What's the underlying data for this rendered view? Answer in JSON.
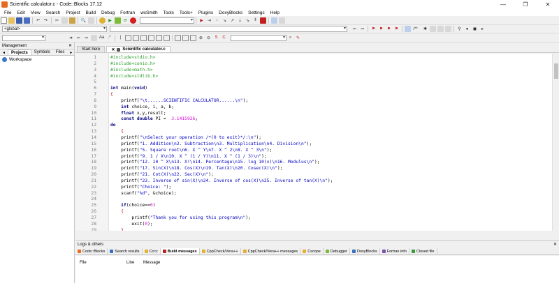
{
  "window": {
    "title": "Scientific calculator.c - Code::Blocks 17.12"
  },
  "menu": [
    "File",
    "Edit",
    "View",
    "Search",
    "Project",
    "Build",
    "Debug",
    "Fortran",
    "wxSmith",
    "Tools",
    "Tools+",
    "Plugins",
    "DoxyBlocks",
    "Settings",
    "Help"
  ],
  "toolbar": {
    "scope_combo": "<global>",
    "search_combo": ""
  },
  "management": {
    "title": "Management",
    "tabs": [
      "Projects",
      "Symbols",
      "Files"
    ],
    "workspace_label": "Workspace"
  },
  "editor": {
    "tabs": [
      "Start here",
      "Scientific calculator.c"
    ],
    "lines": [
      {
        "n": "1",
        "segs": [
          [
            "pp",
            "#include<stdio.h>"
          ]
        ]
      },
      {
        "n": "2",
        "segs": [
          [
            "pp",
            "#include<conio.h>"
          ]
        ]
      },
      {
        "n": "3",
        "segs": [
          [
            "pp",
            "#include<math.h>"
          ]
        ]
      },
      {
        "n": "4",
        "segs": [
          [
            "pp",
            "#include<stdlib.h>"
          ]
        ]
      },
      {
        "n": "5",
        "segs": []
      },
      {
        "n": "6",
        "segs": [
          [
            "kw",
            "int"
          ],
          [
            "def",
            " main("
          ],
          [
            "kw",
            "void"
          ],
          [
            "def",
            ")"
          ]
        ]
      },
      {
        "n": "7",
        "segs": [
          [
            "op",
            "{"
          ]
        ]
      },
      {
        "n": "8",
        "segs": [
          [
            "def",
            "    printf("
          ],
          [
            "str",
            "\"\\t......SCIENTIFIC CALCULATOR......\\n\""
          ],
          [
            "def",
            ");"
          ]
        ]
      },
      {
        "n": "9",
        "segs": [
          [
            "def",
            "    "
          ],
          [
            "kw",
            "int"
          ],
          [
            "def",
            " choice, i, a, b;"
          ]
        ]
      },
      {
        "n": "10",
        "segs": [
          [
            "def",
            "    "
          ],
          [
            "kw",
            "float"
          ],
          [
            "def",
            " x,y,result;"
          ]
        ]
      },
      {
        "n": "11",
        "segs": [
          [
            "def",
            "    "
          ],
          [
            "kw",
            "const double"
          ],
          [
            "def",
            " PI = "
          ],
          [
            "num",
            " 3.1415926"
          ],
          [
            "def",
            ";"
          ]
        ]
      },
      {
        "n": "12",
        "segs": [
          [
            "kw",
            "do"
          ]
        ]
      },
      {
        "n": "13",
        "segs": [
          [
            "def",
            "    "
          ],
          [
            "op",
            "{"
          ]
        ]
      },
      {
        "n": "14",
        "segs": [
          [
            "def",
            "    printf("
          ],
          [
            "str",
            "\"\\nSelect your operation /*(0 to exit)*/:\\n\""
          ],
          [
            "def",
            ");"
          ]
        ]
      },
      {
        "n": "15",
        "segs": [
          [
            "def",
            "    printf("
          ],
          [
            "str",
            "\"1. Addition\\n2. Subtraction\\n3. Multiplication\\n4. Division\\n\""
          ],
          [
            "def",
            ");"
          ]
        ]
      },
      {
        "n": "16",
        "segs": [
          [
            "def",
            "    printf("
          ],
          [
            "str",
            "\"5. Square root\\n6. X ^ Y\\n7. X ^ 2\\n8. X ^ 3\\n\""
          ],
          [
            "def",
            ");"
          ]
        ]
      },
      {
        "n": "17",
        "segs": [
          [
            "def",
            "    printf("
          ],
          [
            "str",
            "\"9. 1 / X\\n10. X ^ (1 / Y)\\n11. X ^ (1 / 3)\\n\""
          ],
          [
            "def",
            ");"
          ]
        ]
      },
      {
        "n": "18",
        "segs": [
          [
            "def",
            "    printf("
          ],
          [
            "str",
            "\"12. 10 ^ X\\n13. X!\\n14. Percentage\\n15. log 10(x)\\n16. Modulus\\n\""
          ],
          [
            "def",
            ");"
          ]
        ]
      },
      {
        "n": "19",
        "segs": [
          [
            "def",
            "    printf("
          ],
          [
            "str",
            "\"17. Sin(X)\\n18. Cos(X)\\n19. Tan(X)\\n20. Cosec(X)\\n\""
          ],
          [
            "def",
            ");"
          ]
        ]
      },
      {
        "n": "20",
        "segs": [
          [
            "def",
            "    printf("
          ],
          [
            "str",
            "\"21. Cot(X)\\n22. Sec(X)\\n\""
          ],
          [
            "def",
            ");"
          ]
        ]
      },
      {
        "n": "21",
        "segs": [
          [
            "def",
            "    printf("
          ],
          [
            "str",
            "\"23. Inverse of sin(X)\\n24. Inverse of cos(X)\\n25. Inverse of tan(X)\\n\""
          ],
          [
            "def",
            ");"
          ]
        ]
      },
      {
        "n": "22",
        "segs": [
          [
            "def",
            "    printf("
          ],
          [
            "str",
            "\"Choice: \""
          ],
          [
            "def",
            ");"
          ]
        ]
      },
      {
        "n": "23",
        "segs": [
          [
            "def",
            "    scanf("
          ],
          [
            "str",
            "\"%d\""
          ],
          [
            "def",
            ", &choice);"
          ]
        ]
      },
      {
        "n": "24",
        "segs": []
      },
      {
        "n": "25",
        "segs": [
          [
            "def",
            "    "
          ],
          [
            "kw",
            "if"
          ],
          [
            "def",
            "(choice=="
          ],
          [
            "num",
            "0"
          ],
          [
            "def",
            ")"
          ]
        ]
      },
      {
        "n": "26",
        "segs": [
          [
            "def",
            "    "
          ],
          [
            "op",
            "{"
          ]
        ]
      },
      {
        "n": "27",
        "segs": [
          [
            "def",
            "        printf("
          ],
          [
            "str",
            "\"Thank you for using this program\\n\""
          ],
          [
            "def",
            ");"
          ]
        ]
      },
      {
        "n": "28",
        "segs": [
          [
            "def",
            "        exit("
          ],
          [
            "num",
            "0"
          ],
          [
            "def",
            ");"
          ]
        ]
      },
      {
        "n": "29",
        "segs": [
          [
            "def",
            "    "
          ],
          [
            "op",
            "}"
          ]
        ]
      }
    ]
  },
  "logs": {
    "title": "Logs & others",
    "tabs": [
      "Code::Blocks",
      "Search results",
      "Cccc",
      "Build messages",
      "CppCheck/Vera++",
      "CppCheck/Vera++ messages",
      "Cscope",
      "Debugger",
      "DoxyBlocks",
      "Fortran info",
      "Closed file"
    ],
    "columns": [
      "File",
      "Line",
      "Message"
    ]
  },
  "colors": {
    "preprocessor": "#2ca02c",
    "keyword": "#000080",
    "string": "#0000c0",
    "number": "#e000e0",
    "brace": "#c00000"
  }
}
